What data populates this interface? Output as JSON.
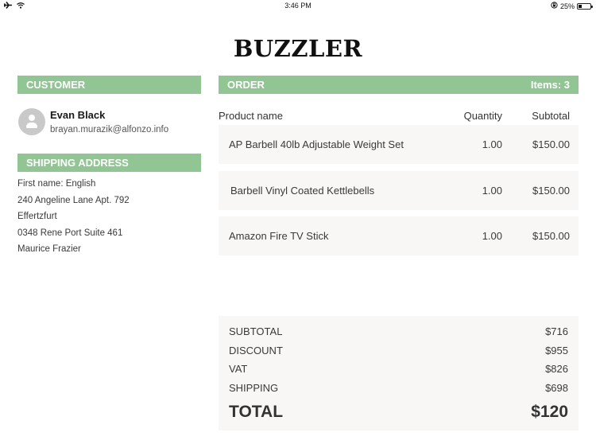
{
  "status_bar": {
    "time": "3:46 PM",
    "battery_percent": "25%",
    "battery_level": 0.25,
    "icons": [
      "airplane-icon",
      "wifi-icon",
      "rotation-lock-icon",
      "battery-icon"
    ]
  },
  "brand": "BUZZLER",
  "customer": {
    "header": "CUSTOMER",
    "name": "Evan Black",
    "email": "brayan.murazik@alfonzo.info",
    "avatar_icon": "user-icon"
  },
  "shipping": {
    "header": "SHIPPING ADDRESS",
    "lines": [
      "First name: English",
      "240 Angeline Lane Apt. 792",
      "Effertzfurt",
      "0348 Rene Port Suite 461",
      "Maurice Frazier"
    ]
  },
  "order": {
    "header": "ORDER",
    "items_count": "Items: 3",
    "columns": [
      "Product name",
      "Quantity",
      "Subtotal"
    ],
    "rows": [
      {
        "name": "AP Barbell 40lb Adjustable Weight Set",
        "qty": "1.00",
        "subtotal": "$150.00"
      },
      {
        "name": "Barbell Vinyl Coated Kettlebells",
        "qty": "1.00",
        "subtotal": "$150.00"
      },
      {
        "name": "Amazon Fire TV Stick",
        "qty": "1.00",
        "subtotal": "$150.00"
      }
    ]
  },
  "totals": {
    "subtotal": {
      "label": "SUBTOTAL",
      "value": "$716"
    },
    "discount": {
      "label": "DISCOUNT",
      "value": "$955"
    },
    "vat": {
      "label": "VAT",
      "value": "$826"
    },
    "shipping": {
      "label": "SHIPPING",
      "value": "$698"
    },
    "total": {
      "label": "TOTAL",
      "value": "$120"
    }
  },
  "colors": {
    "accent": "#92c594",
    "row_bg": "#f8f7f6"
  }
}
